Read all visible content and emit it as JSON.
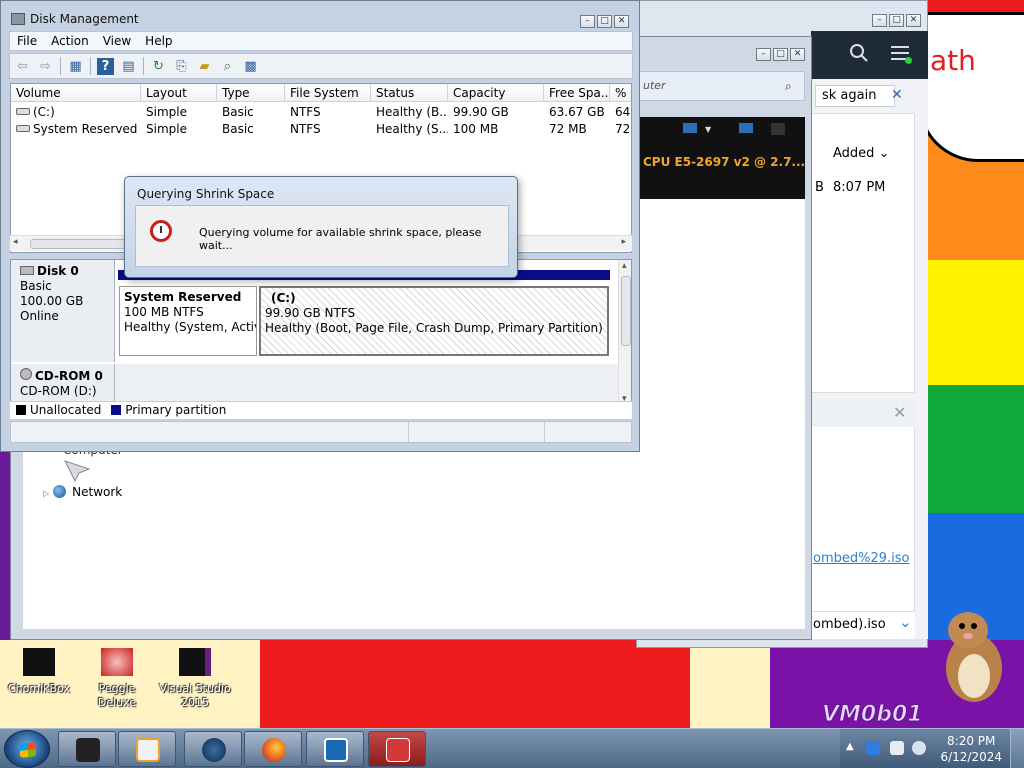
{
  "desktop": {
    "bubble_text": "ath",
    "watermark": "VM0b01",
    "icons": [
      {
        "label": "ChomikBox"
      },
      {
        "label": "Peggle Deluxe"
      },
      {
        "label": "Visual Studio 2015"
      }
    ],
    "colors": {
      "red": "#ee1c1c",
      "orange": "#ff8a1c",
      "yellow": "#fff200",
      "green": "#11a83c",
      "blue": "#1a6ae0",
      "purple": "#7a12a8"
    }
  },
  "browser_window": {
    "try_again": "sk again",
    "added_header": "Added",
    "row_fragment": "B",
    "row_time": "8:07 PM",
    "link_text": "ombed%29.iso",
    "file_text": "ombed).iso"
  },
  "explorer_window": {
    "address_text": "uter",
    "cpu_text": "CPU E5-2697 v2 @ 2.7...",
    "nav_computer": "Computer",
    "nav_network": "Network"
  },
  "disk_management": {
    "title": "Disk Management",
    "menu": [
      "File",
      "Action",
      "View",
      "Help"
    ],
    "columns": [
      "Volume",
      "Layout",
      "Type",
      "File System",
      "Status",
      "Capacity",
      "Free Spa...",
      "%"
    ],
    "rows": [
      {
        "volume": "(C:)",
        "layout": "Simple",
        "type": "Basic",
        "fs": "NTFS",
        "status": "Healthy (B...",
        "capacity": "99.90 GB",
        "free": "63.67 GB",
        "pct": "64"
      },
      {
        "volume": "System Reserved",
        "layout": "Simple",
        "type": "Basic",
        "fs": "NTFS",
        "status": "Healthy (S...",
        "capacity": "100 MB",
        "free": "72 MB",
        "pct": "72"
      }
    ],
    "disk0": {
      "name": "Disk 0",
      "type": "Basic",
      "size": "100.00 GB",
      "state": "Online"
    },
    "cdrom0": {
      "name": "CD-ROM 0",
      "drive": "CD-ROM (D:)"
    },
    "partitions": [
      {
        "name": "System Reserved",
        "size": "100 MB NTFS",
        "status": "Healthy (System, Active"
      },
      {
        "name": "(C:)",
        "size": "99.90 GB NTFS",
        "status": "Healthy (Boot, Page File, Crash Dump, Primary Partition)"
      }
    ],
    "legend": [
      {
        "label": "Unallocated",
        "color": "#000000"
      },
      {
        "label": "Primary partition",
        "color": "#0b0b8a"
      }
    ]
  },
  "dialog": {
    "title": "Querying Shrink Space",
    "message": "Querying volume for available shrink space, please wait..."
  },
  "taskbar": {
    "time": "8:20 PM",
    "date": "6/12/2024"
  }
}
